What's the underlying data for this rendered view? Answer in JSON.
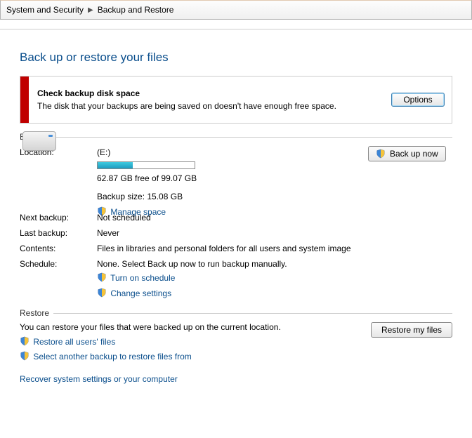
{
  "breadcrumb": {
    "item1": "System and Security",
    "item2": "Backup and Restore"
  },
  "title": "Back up or restore your files",
  "alert": {
    "title": "Check backup disk space",
    "desc": "The disk that your backups are being saved on doesn't have enough free space.",
    "options_btn": "Options"
  },
  "backup": {
    "heading": "Backup",
    "location_label": "Location:",
    "drive": "(E:)",
    "free_text": "62.87 GB free of 99.07 GB",
    "size_text": "Backup size: 15.08 GB",
    "manage_space": "Manage space",
    "backup_now_btn": "Back up now",
    "next_label": "Next backup:",
    "next_value": "Not scheduled",
    "last_label": "Last backup:",
    "last_value": "Never",
    "contents_label": "Contents:",
    "contents_value": "Files in libraries and personal folders for all users and system image",
    "schedule_label": "Schedule:",
    "schedule_value": "None. Select Back up now to run backup manually.",
    "turn_on": "Turn on schedule",
    "change_settings": "Change settings"
  },
  "restore": {
    "heading": "Restore",
    "desc": "You can restore your files that were backed up on the current location.",
    "restore_btn": "Restore my files",
    "restore_all": "Restore all users' files",
    "select_another": "Select another backup to restore files from",
    "recover": "Recover system settings or your computer"
  }
}
